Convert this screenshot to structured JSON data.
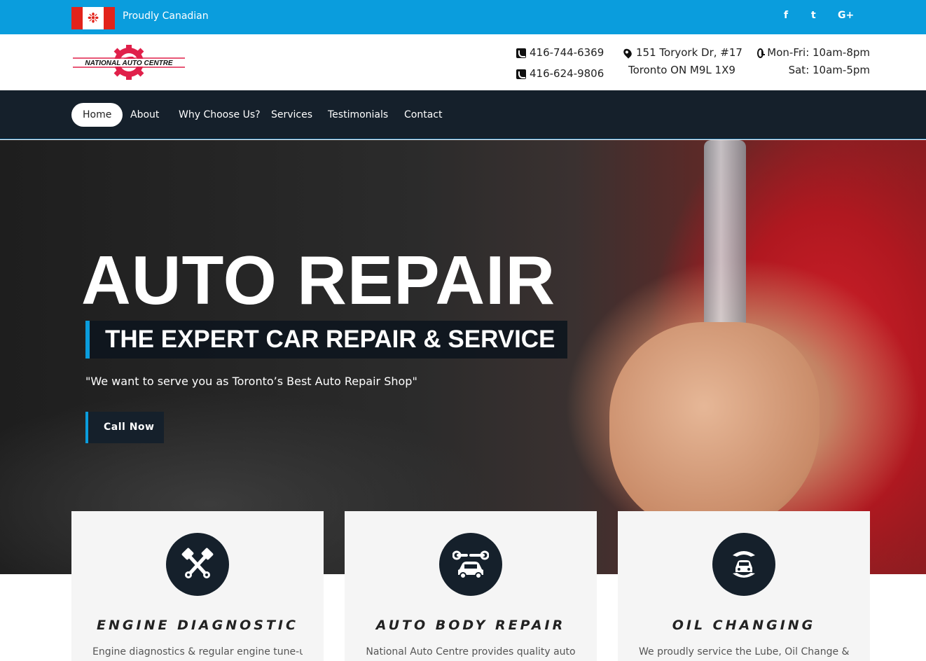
{
  "topbar": {
    "tagline": "Proudly Canadian",
    "social_icons": [
      "facebook-icon",
      "twitter-icon",
      "google-plus-icon"
    ],
    "social_glyphs": [
      "f",
      "t",
      "G+"
    ]
  },
  "header": {
    "logo_text": "NATIONAL AUTO CENTRE",
    "phones": [
      "416-744-6369",
      "416-624-9806"
    ],
    "address": [
      "151 Toryork Dr, #17",
      "Toronto ON M9L 1X9"
    ],
    "hours": [
      "Mon-Fri: 10am-8pm",
      "Sat: 10am-5pm"
    ]
  },
  "nav": {
    "items": [
      "Home",
      "About",
      "Why Choose Us?",
      "Services",
      "Testimonials",
      "Contact"
    ],
    "active": "Home"
  },
  "hero": {
    "title": "AUTO REPAIR",
    "subtitle": "THE EXPERT CAR REPAIR & SERVICE",
    "quote": "\"We want to serve you as Toronto’s Best Auto Repair Shop\"",
    "cta": "Call Now"
  },
  "cards": [
    {
      "icon": "pistons-icon",
      "title": "ENGINE DIAGNOSTIC",
      "text": "Engine diagnostics & regular engine tune-ups"
    },
    {
      "icon": "car-wrench-icon",
      "title": "AUTO BODY REPAIR",
      "text": "National Auto Centre provides quality auto"
    },
    {
      "icon": "car-hands-icon",
      "title": "OIL CHANGING",
      "text": "We proudly service the Lube, Oil Change &"
    }
  ],
  "colors": {
    "accent": "#0a9ddd",
    "dark": "#15202b",
    "logo_red": "#e0204a"
  }
}
